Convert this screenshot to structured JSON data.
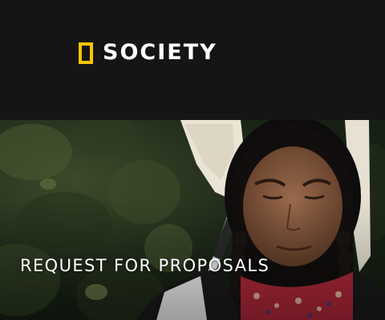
{
  "header": {
    "brand": {
      "mark": "yellow-border-rectangle",
      "name": "SOCIETY",
      "accent_color": "#f6c500"
    }
  },
  "hero": {
    "title": "REQUEST FOR PROPOSALS",
    "image": "photo-of-woman-in-forest-holding-net-pole"
  }
}
